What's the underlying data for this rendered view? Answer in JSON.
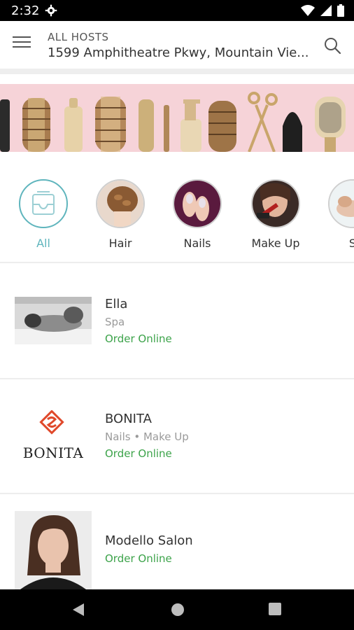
{
  "status_bar": {
    "time": "2:32"
  },
  "header": {
    "subtitle": "ALL HOSTS",
    "address": "1599 Amphitheatre Pkwy, Mountain Vie..."
  },
  "categories": [
    {
      "label": "All",
      "icon": "inbox-icon",
      "active": true
    },
    {
      "label": "Hair",
      "icon": "hair-photo"
    },
    {
      "label": "Nails",
      "icon": "nails-photo"
    },
    {
      "label": "Make Up",
      "icon": "makeup-photo"
    },
    {
      "label": "S",
      "icon": "spa-photo"
    }
  ],
  "listings": [
    {
      "name": "Ella",
      "categories": "Spa",
      "order": "Order Online"
    },
    {
      "name": "BONITA",
      "categories": "Nails • Make Up",
      "order": "Order Online",
      "logo_text": "BONITA"
    },
    {
      "name": "Modello Salon",
      "categories": "",
      "order": "Order Online"
    }
  ],
  "colors": {
    "accent": "#5fb5bd",
    "order_green": "#3ca34a",
    "banner_pink": "#f6d3d8",
    "bonita_orange": "#e0492b"
  }
}
